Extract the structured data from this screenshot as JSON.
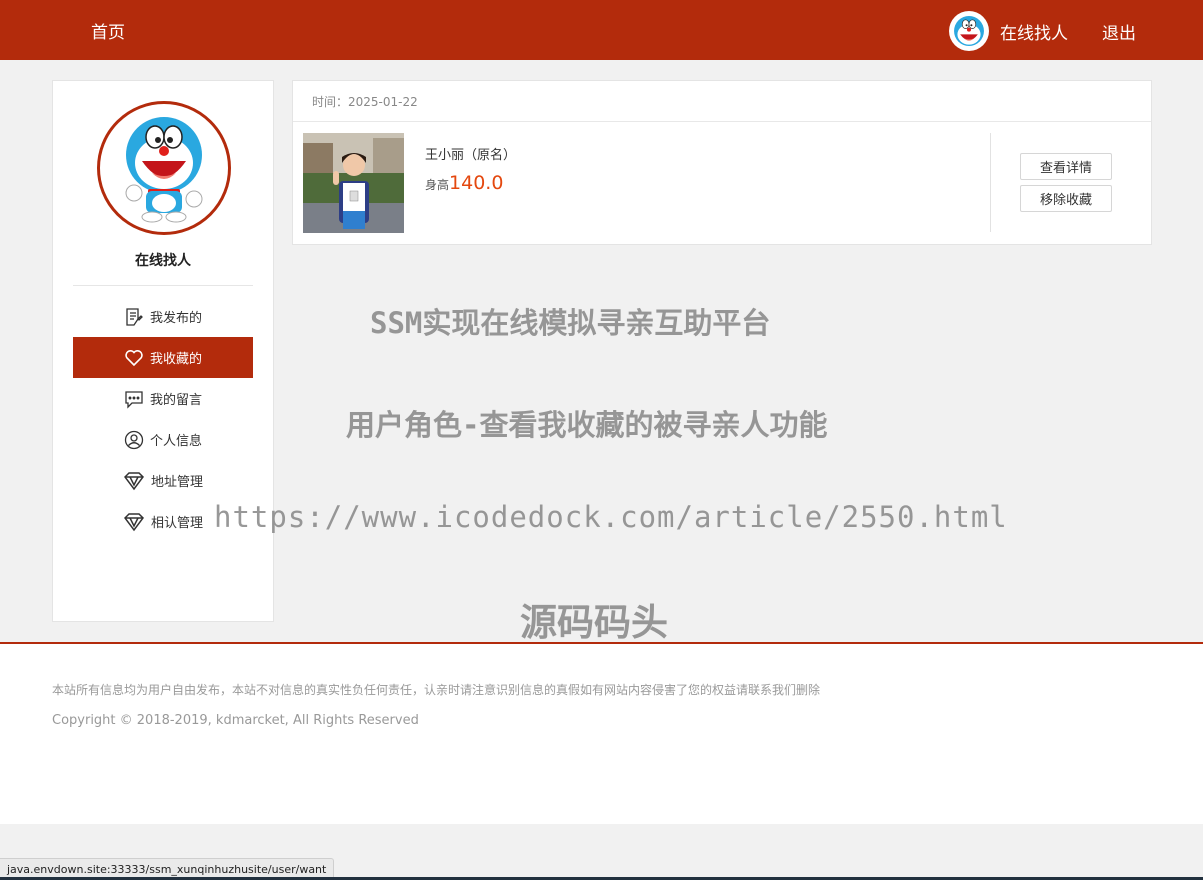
{
  "header": {
    "home_label": "首页",
    "username": "在线找人",
    "logout_label": "退出",
    "brand_color": "#b32b0c"
  },
  "sidebar": {
    "name": "在线找人",
    "items": [
      {
        "label": "我发布的",
        "icon": "document-edit-icon",
        "active": false
      },
      {
        "label": "我收藏的",
        "icon": "heart-icon",
        "active": true
      },
      {
        "label": "我的留言",
        "icon": "message-icon",
        "active": false
      },
      {
        "label": "个人信息",
        "icon": "user-circle-icon",
        "active": false
      },
      {
        "label": "地址管理",
        "icon": "diamond-icon",
        "active": false
      },
      {
        "label": "相认管理",
        "icon": "diamond-icon",
        "active": false
      }
    ]
  },
  "favorites": {
    "time_label": "时间：2025-01-22",
    "entries": [
      {
        "name": "王小丽（原名）",
        "height_label": "身高",
        "height_value": "140.0",
        "view_label": "查看详情",
        "remove_label": "移除收藏"
      }
    ]
  },
  "watermark": {
    "line1": "SSM实现在线模拟寻亲互助平台",
    "line2": "用户角色-查看我收藏的被寻亲人功能",
    "line3": "https://www.icodedock.com/article/2550.html",
    "line4": "源码码头"
  },
  "footer": {
    "disclaimer": "本站所有信息均为用户自由发布，本站不对信息的真实性负任何责任，认亲时请注意识别信息的真假如有网站内容侵害了您的权益请联系我们删除",
    "copyright": "Copyright © 2018-2019, kdmarcket, All Rights Reserved"
  },
  "status_bar": {
    "url": "java.envdown.site:33333/ssm_xunqinhuzhusite/user/want"
  }
}
